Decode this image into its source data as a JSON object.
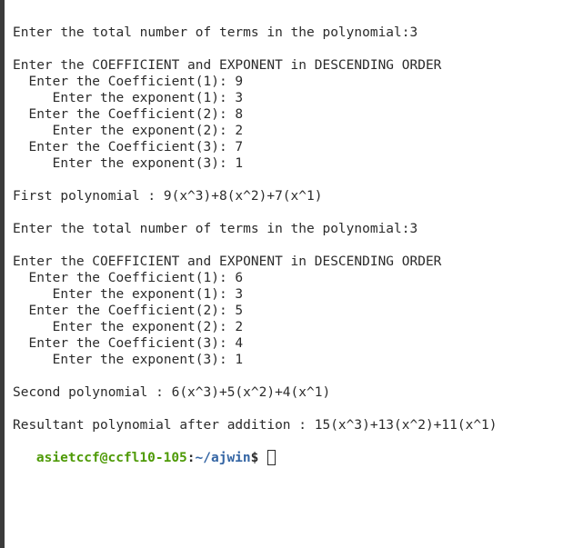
{
  "terminal": {
    "lines": [
      "Enter the total number of terms in the polynomial:3",
      "",
      "Enter the COEFFICIENT and EXPONENT in DESCENDING ORDER",
      "  Enter the Coefficient(1): 9",
      "     Enter the exponent(1): 3",
      "  Enter the Coefficient(2): 8",
      "     Enter the exponent(2): 2",
      "  Enter the Coefficient(3): 7",
      "     Enter the exponent(3): 1",
      "",
      "First polynomial : 9(x^3)+8(x^2)+7(x^1)",
      "",
      "Enter the total number of terms in the polynomial:3",
      "",
      "Enter the COEFFICIENT and EXPONENT in DESCENDING ORDER",
      "  Enter the Coefficient(1): 6",
      "     Enter the exponent(1): 3",
      "  Enter the Coefficient(2): 5",
      "     Enter the exponent(2): 2",
      "  Enter the Coefficient(3): 4",
      "     Enter the exponent(3): 1",
      "",
      "Second polynomial : 6(x^3)+5(x^2)+4(x^1)",
      "",
      "Resultant polynomial after addition : 15(x^3)+13(x^2)+11(x^1)"
    ],
    "prompt": {
      "user_host": "asietccf@ccfl10-105",
      "separator": ":",
      "path": "~/ajwin",
      "symbol": "$ "
    },
    "colors": {
      "background": "#ffffff",
      "text": "#2b2b2b",
      "user_host": "#4e9a06",
      "path": "#3465a4"
    }
  }
}
